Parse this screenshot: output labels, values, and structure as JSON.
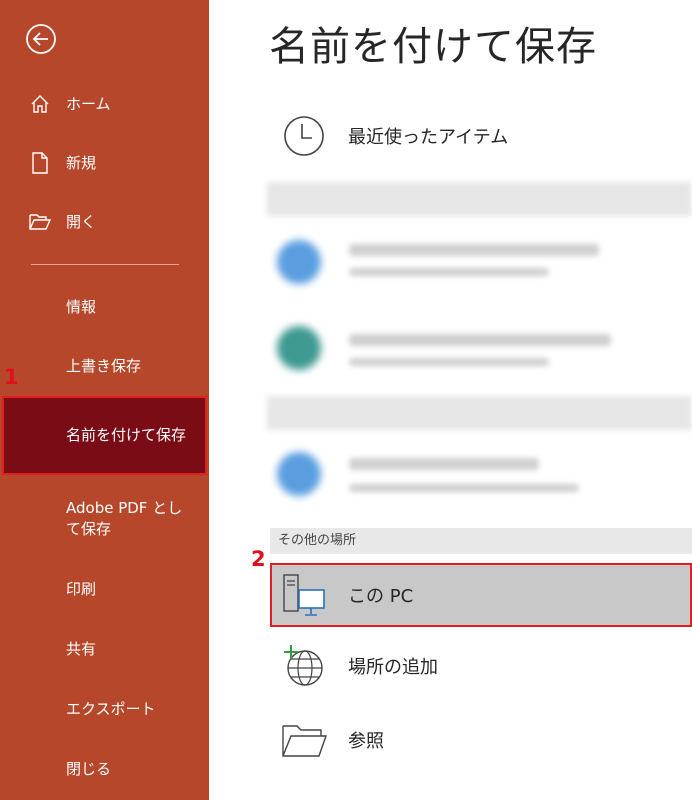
{
  "sidebar": {
    "items": [
      {
        "label": "ホーム",
        "icon": "home-icon"
      },
      {
        "label": "新規",
        "icon": "new-document-icon"
      },
      {
        "label": "開く",
        "icon": "folder-open-icon"
      },
      {
        "label": "情報"
      },
      {
        "label": "上書き保存"
      },
      {
        "label": "名前を付けて保存",
        "selected": true
      },
      {
        "label": "Adobe PDF として保存"
      },
      {
        "label": "印刷"
      },
      {
        "label": "共有"
      },
      {
        "label": "エクスポート"
      },
      {
        "label": "閉じる"
      }
    ]
  },
  "markers": {
    "step1": "1",
    "step2": "2"
  },
  "main": {
    "title": "名前を付けて保存",
    "recent_label": "最近使ったアイテム",
    "other_locations_header": "その他の場所",
    "this_pc_label": "この PC",
    "add_place_label": "場所の追加",
    "browse_label": "参照"
  },
  "colors": {
    "sidebar_bg": "#b7472a",
    "selected_bg": "#7a0c16",
    "highlight_border": "#e02020",
    "marker": "#e0101a"
  }
}
